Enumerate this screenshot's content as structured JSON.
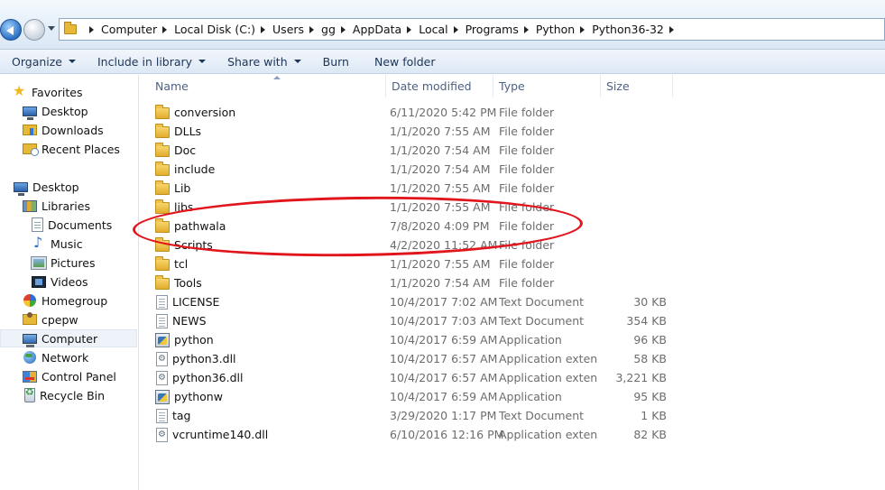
{
  "address_bar": {
    "breadcrumbs": [
      "Computer",
      "Local Disk (C:)",
      "Users",
      "gg",
      "AppData",
      "Local",
      "Programs",
      "Python",
      "Python36-32"
    ]
  },
  "toolbar": {
    "organize": "Organize",
    "include_in_library": "Include in library",
    "share_with": "Share with",
    "burn": "Burn",
    "new_folder": "New folder"
  },
  "nav_pane": {
    "favorites": "Favorites",
    "desktop_fav": "Desktop",
    "downloads": "Downloads",
    "recent_places": "Recent Places",
    "desktop": "Desktop",
    "libraries": "Libraries",
    "documents": "Documents",
    "music": "Music",
    "pictures": "Pictures",
    "videos": "Videos",
    "homegroup": "Homegroup",
    "cpepw": "cpepw",
    "computer": "Computer",
    "network": "Network",
    "control_panel": "Control Panel",
    "recycle_bin": "Recycle Bin"
  },
  "columns": {
    "name": "Name",
    "date_modified": "Date modified",
    "type": "Type",
    "size": "Size"
  },
  "files": [
    {
      "name": "conversion",
      "date": "6/11/2020 5:42 PM",
      "type": "File folder",
      "size": "",
      "icon": "folder-icon"
    },
    {
      "name": "DLLs",
      "date": "1/1/2020 7:55 AM",
      "type": "File folder",
      "size": "",
      "icon": "folder-icon"
    },
    {
      "name": "Doc",
      "date": "1/1/2020 7:54 AM",
      "type": "File folder",
      "size": "",
      "icon": "folder-icon"
    },
    {
      "name": "include",
      "date": "1/1/2020 7:54 AM",
      "type": "File folder",
      "size": "",
      "icon": "folder-icon"
    },
    {
      "name": "Lib",
      "date": "1/1/2020 7:55 AM",
      "type": "File folder",
      "size": "",
      "icon": "folder-icon"
    },
    {
      "name": "libs",
      "date": "1/1/2020 7:55 AM",
      "type": "File folder",
      "size": "",
      "icon": "folder-icon"
    },
    {
      "name": "pathwala",
      "date": "7/8/2020 4:09 PM",
      "type": "File folder",
      "size": "",
      "icon": "folder-icon"
    },
    {
      "name": "Scripts",
      "date": "4/2/2020 11:52 AM",
      "type": "File folder",
      "size": "",
      "icon": "folder-icon"
    },
    {
      "name": "tcl",
      "date": "1/1/2020 7:55 AM",
      "type": "File folder",
      "size": "",
      "icon": "folder-icon"
    },
    {
      "name": "Tools",
      "date": "1/1/2020 7:54 AM",
      "type": "File folder",
      "size": "",
      "icon": "folder-icon"
    },
    {
      "name": "LICENSE",
      "date": "10/4/2017 7:02 AM",
      "type": "Text Document",
      "size": "30 KB",
      "icon": "text-document-icon"
    },
    {
      "name": "NEWS",
      "date": "10/4/2017 7:03 AM",
      "type": "Text Document",
      "size": "354 KB",
      "icon": "text-document-icon"
    },
    {
      "name": "python",
      "date": "10/4/2017 6:59 AM",
      "type": "Application",
      "size": "96 KB",
      "icon": "python-app-icon"
    },
    {
      "name": "python3.dll",
      "date": "10/4/2017 6:57 AM",
      "type": "Application extens...",
      "size": "58 KB",
      "icon": "dll-icon"
    },
    {
      "name": "python36.dll",
      "date": "10/4/2017 6:57 AM",
      "type": "Application extens...",
      "size": "3,221 KB",
      "icon": "dll-icon"
    },
    {
      "name": "pythonw",
      "date": "10/4/2017 6:59 AM",
      "type": "Application",
      "size": "95 KB",
      "icon": "python-app-icon"
    },
    {
      "name": "tag",
      "date": "3/29/2020 1:17 PM",
      "type": "Text Document",
      "size": "1 KB",
      "icon": "text-document-icon"
    },
    {
      "name": "vcruntime140.dll",
      "date": "6/10/2016 12:16 PM",
      "type": "Application extens...",
      "size": "82 KB",
      "icon": "dll-icon"
    }
  ],
  "annotation": {
    "highlighted_item": "pathwala",
    "color": "#e1161d"
  }
}
